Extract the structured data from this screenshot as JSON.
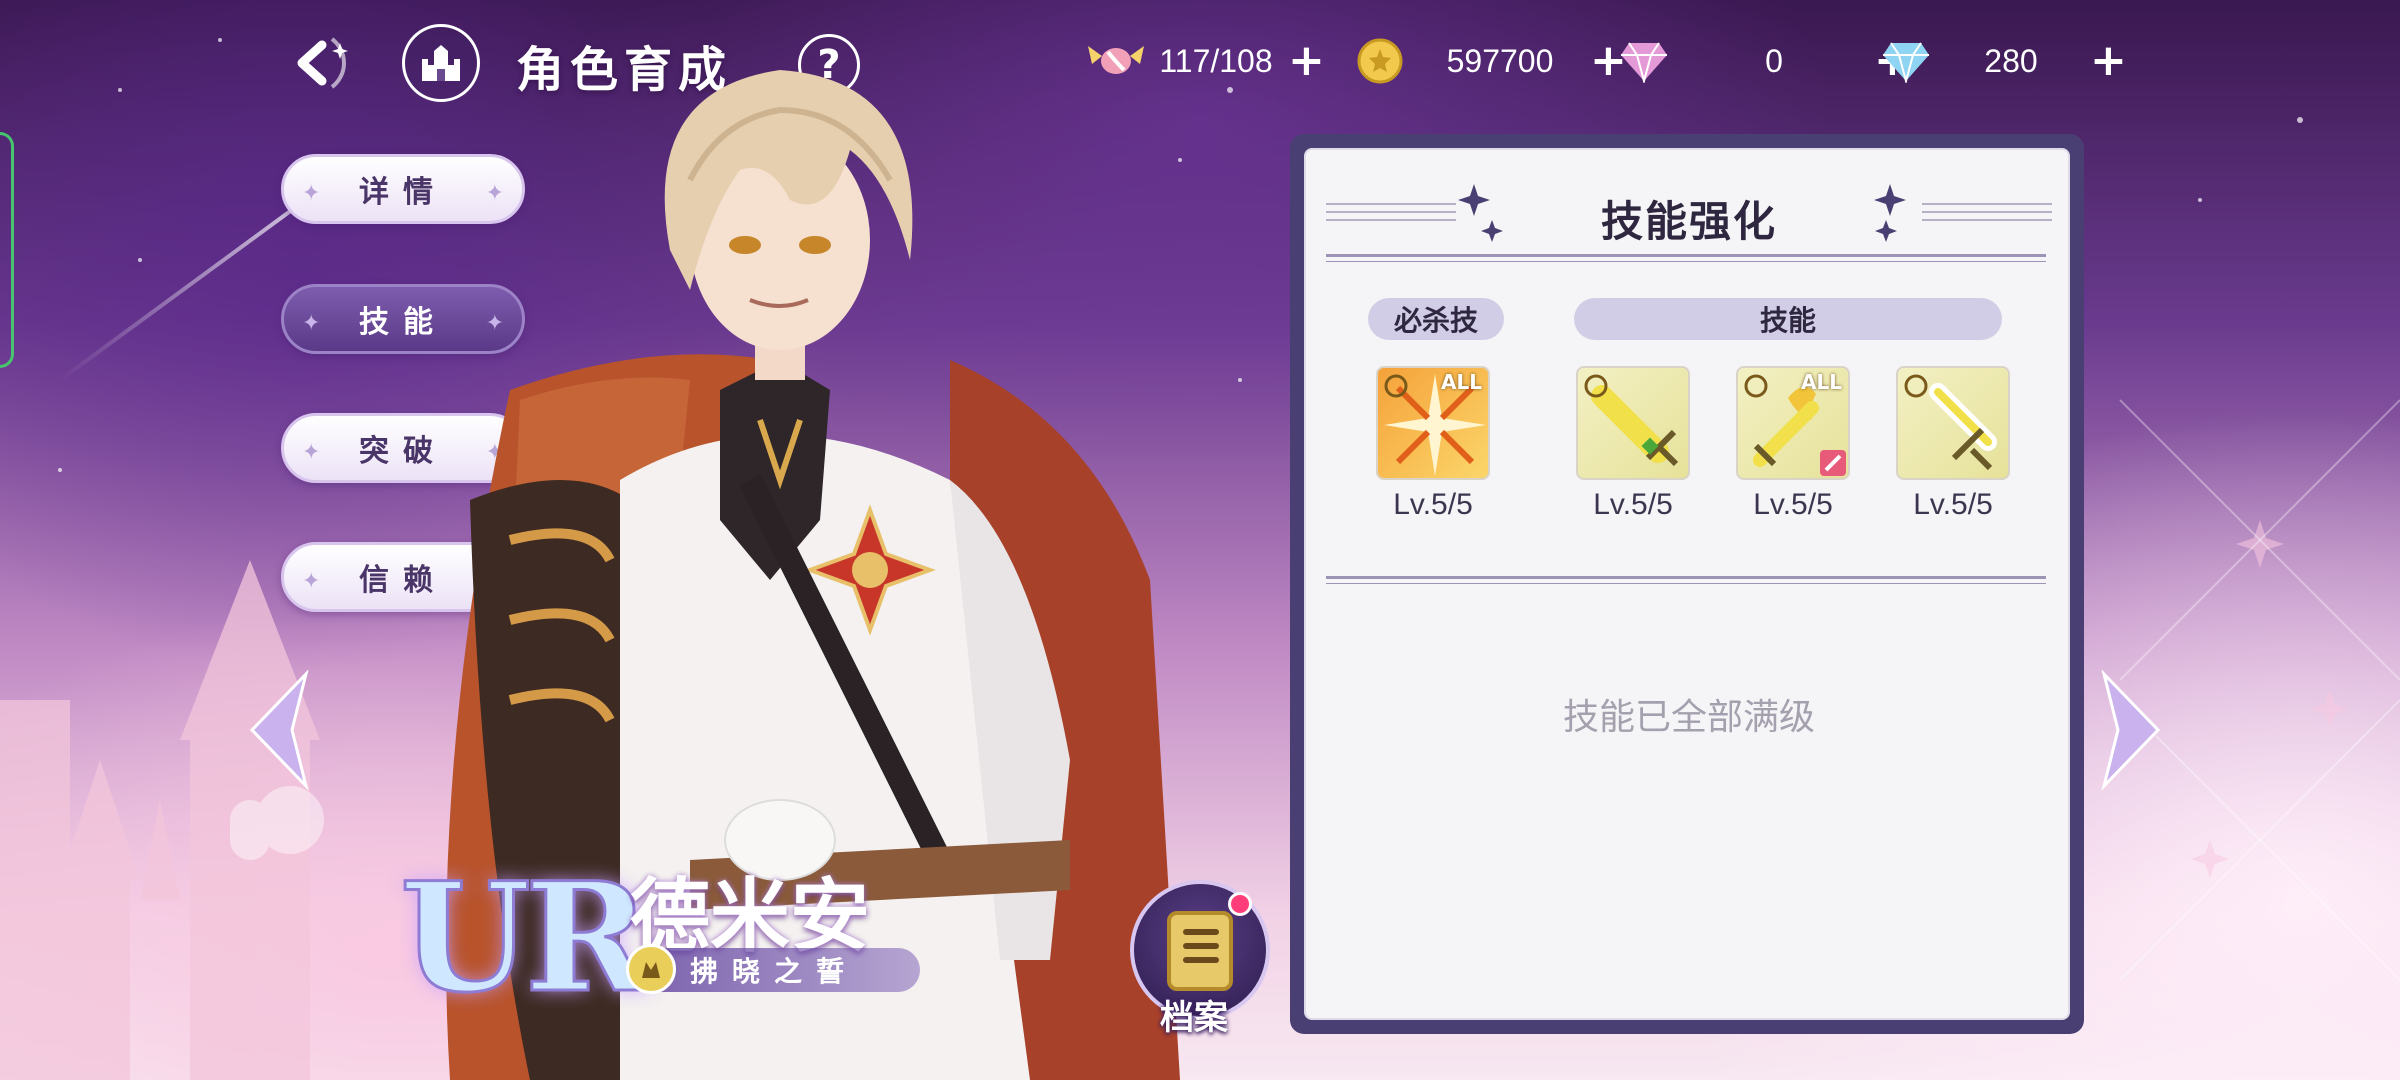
{
  "header": {
    "title": "角色育成",
    "help_label": "?"
  },
  "resources": [
    {
      "name": "stamina",
      "icon": "candy-icon",
      "value": "117/108",
      "plus": "+"
    },
    {
      "name": "gold",
      "icon": "coin-icon",
      "value": "597700",
      "plus": "+"
    },
    {
      "name": "gem-pink",
      "icon": "pink-diamond-icon",
      "value": "0",
      "plus": "+"
    },
    {
      "name": "gem-blue",
      "icon": "blue-diamond-icon",
      "value": "280",
      "plus": "+"
    }
  ],
  "menu": {
    "items": [
      {
        "label": "详情",
        "active": false
      },
      {
        "label": "技能",
        "active": true
      },
      {
        "label": "突破",
        "active": false
      },
      {
        "label": "信赖",
        "active": false
      }
    ]
  },
  "character": {
    "rarity": "UR",
    "name": "德米安",
    "epithet": "拂晓之誓"
  },
  "archive": {
    "label": "档案"
  },
  "panel": {
    "title": "技能强化",
    "ultimate_tag": "必杀技",
    "skill_tag": "技能",
    "skills": [
      {
        "icon": "ultimate-burst-icon",
        "badge": "ALL",
        "level": "Lv.5/5"
      },
      {
        "icon": "sword-shield-skill-icon",
        "badge": "",
        "level": "Lv.5/5"
      },
      {
        "icon": "sword-flame-skill-icon",
        "badge": "ALL",
        "level": "Lv.5/5"
      },
      {
        "icon": "sword-slash-skill-icon",
        "badge": "",
        "level": "Lv.5/5"
      }
    ],
    "status_text": "技能已全部满级"
  },
  "colors": {
    "panel_frame": "#4a3f72",
    "active_menu": "#5a3a88",
    "tag_bg": "#d2cde6"
  }
}
